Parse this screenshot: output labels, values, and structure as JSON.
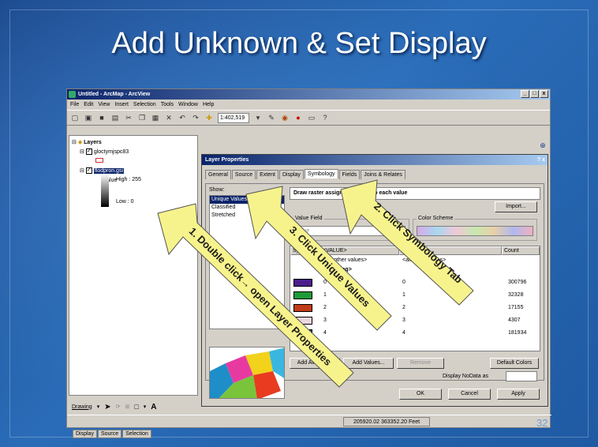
{
  "slide": {
    "title": "Add Unknown & Set Display",
    "number": "32"
  },
  "app": {
    "title": "Untitled - ArcMap - ArcView",
    "win_controls": [
      "_",
      "□",
      "x"
    ],
    "menu": [
      "File",
      "Edit",
      "View",
      "Insert",
      "Selection",
      "Tools",
      "Window",
      "Help"
    ],
    "scale": "1:402,519",
    "toc": {
      "root": "Layers",
      "layer1": "gloctymjspc83",
      "layer2": "flodpron.gsi",
      "legend_field": "Value",
      "legend_high": "High : 255",
      "legend_low": "Low : 0",
      "tabs": [
        "Display",
        "Source",
        "Selection"
      ]
    },
    "drawing_label": "Drawing",
    "statusbar_coords": "205920.02  363352.20 Feet"
  },
  "dialog": {
    "title": "Layer Properties",
    "help_close": "? x",
    "tabs": [
      "General",
      "Source",
      "Extent",
      "Display",
      "Symbology",
      "Fields",
      "Joins & Relates"
    ],
    "active_tab": "Symbology",
    "show_label": "Show:",
    "show_items": [
      "Unique Values",
      "Classified",
      "Stretched"
    ],
    "description": "Draw raster assigning a color to each value",
    "import_label": "Import...",
    "value_field_label": "Value Field",
    "value_field_value": "Value",
    "color_scheme_label": "Color Scheme",
    "table": {
      "headers": [
        "Symbol",
        "<VALUE>",
        "Label",
        "Count"
      ],
      "other_values": "<all other values>",
      "other_label": "<all other values>",
      "heading": "<Heading>",
      "rows": [
        {
          "value": "0",
          "label": "0",
          "count": "300796",
          "color": "#4a1d8c"
        },
        {
          "value": "1",
          "label": "1",
          "count": "32328",
          "color": "#1f9a3a"
        },
        {
          "value": "2",
          "label": "2",
          "count": "17155",
          "color": "#c23a1a"
        },
        {
          "value": "3",
          "label": "3",
          "count": "4307",
          "color": "#ead6dc"
        },
        {
          "value": "4",
          "label": "4",
          "count": "181934",
          "color": "#2d5f5a"
        }
      ]
    },
    "add_all_values": "Add All Values",
    "add_values": "Add Values...",
    "remove": "Remove",
    "default_colors": "Default Colors",
    "display_nodata": "Display NoData as",
    "ok": "OK",
    "cancel": "Cancel",
    "apply": "Apply"
  },
  "callouts": {
    "step1": "1. Double click→ open Layer Properties",
    "step2": "2. Click Symbology Tab",
    "step3": "3. Click Unique Values"
  }
}
